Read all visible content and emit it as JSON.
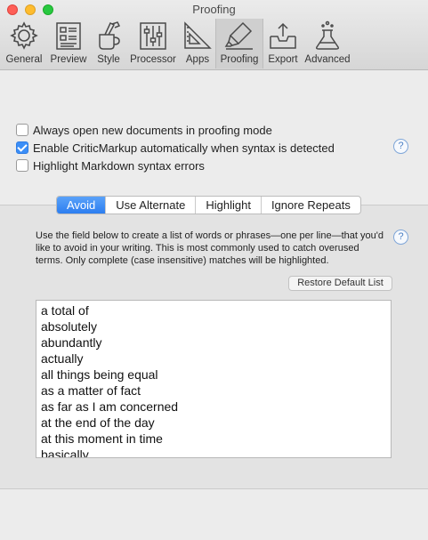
{
  "window": {
    "title": "Proofing"
  },
  "toolbar": {
    "items": [
      {
        "label": "General",
        "icon": "gear-icon"
      },
      {
        "label": "Preview",
        "icon": "preview-icon"
      },
      {
        "label": "Style",
        "icon": "style-icon"
      },
      {
        "label": "Processor",
        "icon": "sliders-icon"
      },
      {
        "label": "Apps",
        "icon": "apps-icon"
      },
      {
        "label": "Proofing",
        "icon": "highlighter-icon",
        "active": true
      },
      {
        "label": "Export",
        "icon": "export-icon"
      },
      {
        "label": "Advanced",
        "icon": "flask-icon"
      }
    ]
  },
  "options": [
    {
      "label": "Always open new documents in proofing mode",
      "checked": false
    },
    {
      "label": "Enable CriticMarkup automatically when syntax is detected",
      "checked": true
    },
    {
      "label": "Highlight Markdown syntax errors",
      "checked": false
    }
  ],
  "help_glyph": "?",
  "tabs": [
    {
      "label": "Avoid",
      "active": true
    },
    {
      "label": "Use Alternate"
    },
    {
      "label": "Highlight"
    },
    {
      "label": "Ignore Repeats"
    }
  ],
  "avoid": {
    "description": "Use the field below to create a list of words or phrases—one per line—that you'd like to avoid in your writing. This is most commonly used to catch overused terms. Only complete (case insensitive) matches will be highlighted.",
    "restore_label": "Restore Default List",
    "items": [
      "a total of",
      "absolutely",
      "abundantly",
      "actually",
      "all things being equal",
      "as a matter of fact",
      "as far as I am concerned",
      "at the end of the day",
      "at this moment in time",
      "basically"
    ]
  },
  "colors": {
    "accent": "#2c7ef0",
    "checkbox_checked": "#3b8ef7"
  }
}
